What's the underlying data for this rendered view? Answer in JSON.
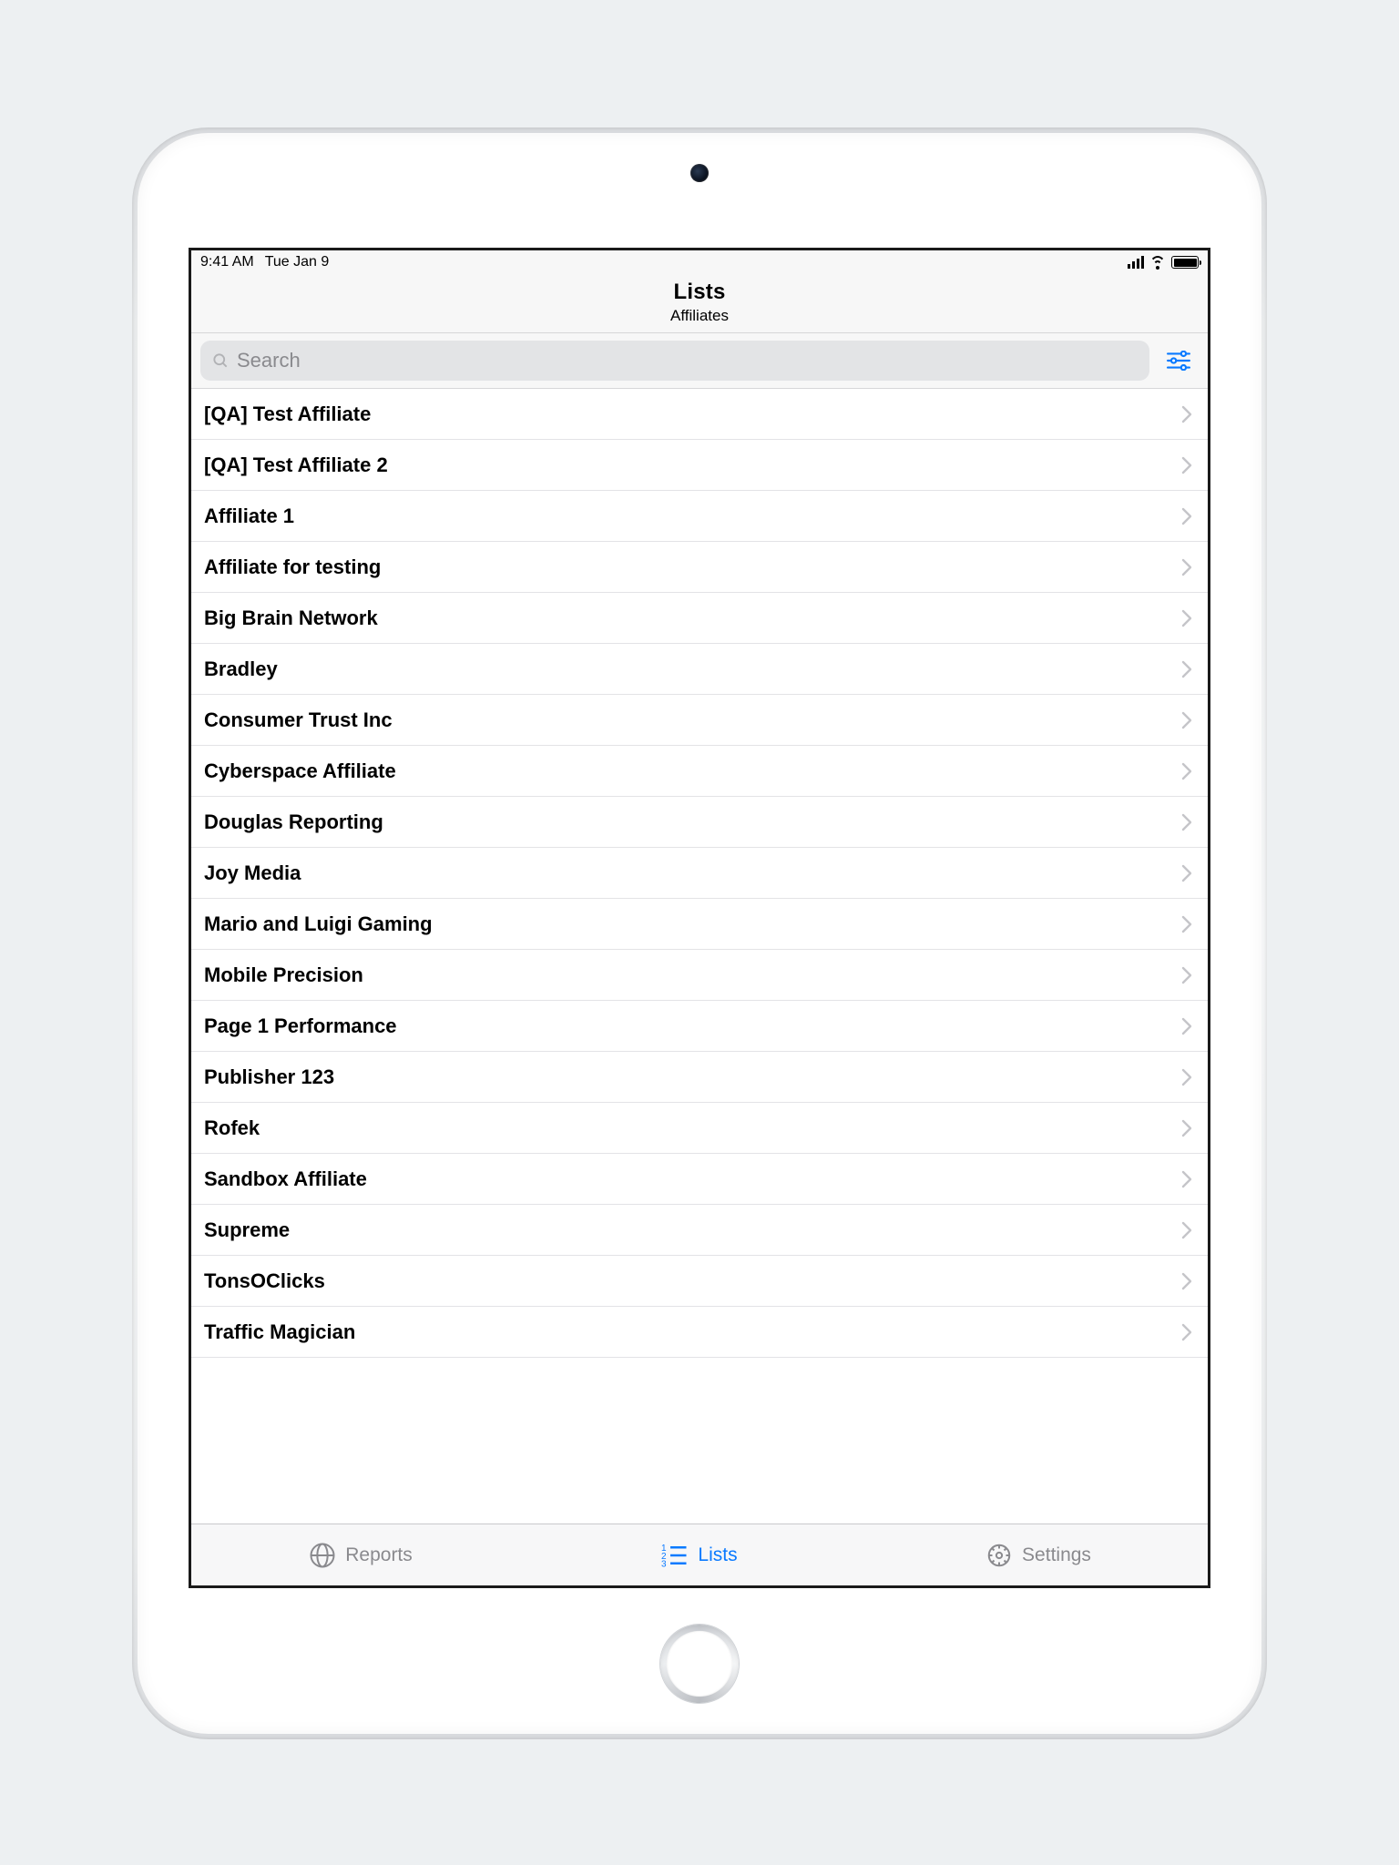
{
  "status": {
    "time": "9:41 AM",
    "date": "Tue Jan 9"
  },
  "nav": {
    "title": "Lists",
    "subtitle": "Affiliates"
  },
  "search": {
    "placeholder": "Search",
    "value": ""
  },
  "items": [
    {
      "label": "[QA] Test Affiliate"
    },
    {
      "label": "[QA] Test Affiliate 2"
    },
    {
      "label": "Affiliate 1"
    },
    {
      "label": "Affiliate for testing"
    },
    {
      "label": "Big Brain Network"
    },
    {
      "label": "Bradley"
    },
    {
      "label": "Consumer Trust Inc"
    },
    {
      "label": "Cyberspace Affiliate"
    },
    {
      "label": "Douglas Reporting"
    },
    {
      "label": "Joy Media"
    },
    {
      "label": "Mario and Luigi Gaming"
    },
    {
      "label": "Mobile Precision"
    },
    {
      "label": "Page 1 Performance"
    },
    {
      "label": "Publisher 123"
    },
    {
      "label": "Rofek"
    },
    {
      "label": "Sandbox Affiliate"
    },
    {
      "label": "Supreme"
    },
    {
      "label": "TonsOClicks"
    },
    {
      "label": "Traffic Magician"
    }
  ],
  "tabs": {
    "reports": "Reports",
    "lists": "Lists",
    "settings": "Settings",
    "active": "lists"
  }
}
